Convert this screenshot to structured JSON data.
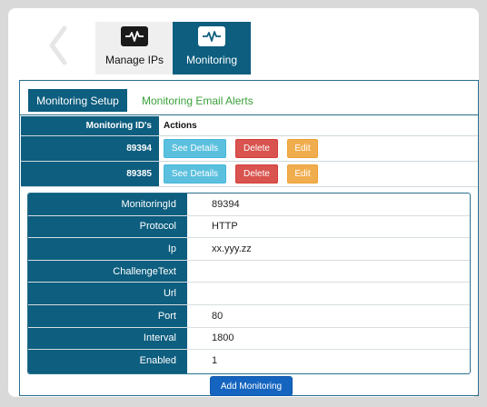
{
  "tabs": {
    "manage_ips": "Manage IPs",
    "monitoring": "Monitoring"
  },
  "subtabs": {
    "setup": "Monitoring Setup",
    "alerts": "Monitoring Email Alerts"
  },
  "ids_table": {
    "col_id": "Monitoring ID's",
    "col_actions": "Actions",
    "rows": [
      {
        "id": "89394",
        "details": "See Details",
        "delete": "Delete",
        "edit": "Edit"
      },
      {
        "id": "89385",
        "details": "See Details",
        "delete": "Delete",
        "edit": "Edit"
      }
    ]
  },
  "details": {
    "rows": [
      {
        "key": "MonitoringId",
        "value": "89394"
      },
      {
        "key": "Protocol",
        "value": "HTTP"
      },
      {
        "key": "Ip",
        "value": "xx.yyy.zz"
      },
      {
        "key": "ChallengeText",
        "value": ""
      },
      {
        "key": "Url",
        "value": ""
      },
      {
        "key": "Port",
        "value": "80"
      },
      {
        "key": "Interval",
        "value": "1800"
      },
      {
        "key": "Enabled",
        "value": "1"
      }
    ]
  },
  "add_button": "Add Monitoring",
  "colors": {
    "primary": "#0d5e7f",
    "info": "#5bc0de",
    "danger": "#d9534f",
    "warning": "#f0ad4e",
    "link_green": "#3aa13a",
    "add_blue": "#1565c0"
  },
  "icons": {
    "back": "chevron-left-icon",
    "manage_ips": "heartbeat-icon",
    "monitoring": "heartbeat-icon"
  }
}
